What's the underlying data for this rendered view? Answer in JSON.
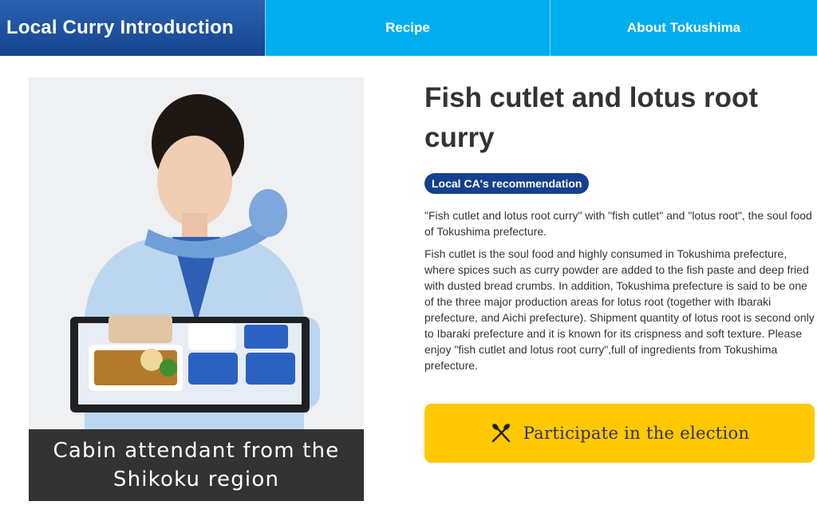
{
  "nav": {
    "title": "Local Curry Introduction",
    "tabs": [
      {
        "label": "Recipe"
      },
      {
        "label": "About Tokushima"
      }
    ]
  },
  "photo": {
    "caption_line1": "Cabin attendant from the",
    "caption_line2": "Shikoku region"
  },
  "dish": {
    "title": "Fish cutlet and lotus root curry",
    "badge": "Local CA's recommendation",
    "paragraphs": [
      "\"Fish cutlet and lotus root curry\" with \"fish cutlet\" and \"lotus root\", the soul food of Tokushima prefecture.",
      "Fish cutlet is the soul food and highly consumed in Tokushima prefecture, where spices such as curry powder are added to the fish paste and deep fried with dusted bread crumbs. In addition, Tokushima prefecture is said to be one of the three major production areas for lotus root (together with Ibaraki prefecture, and Aichi prefecture). Shipment quantity of lotus root is second only to Ibaraki prefecture and it is known for its crispness and soft texture. Please enjoy \"fish cutlet and lotus root curry\",full of ingredients from Tokushima prefecture."
    ]
  },
  "vote": {
    "label": "Participate in the election",
    "icon": "fork-knife-icon"
  },
  "colors": {
    "nav_title_bg": "#17428d",
    "nav_tab_bg": "#00aeef",
    "badge_bg": "#15408f",
    "button_bg": "#ffc800",
    "caption_bg": "#333333"
  }
}
